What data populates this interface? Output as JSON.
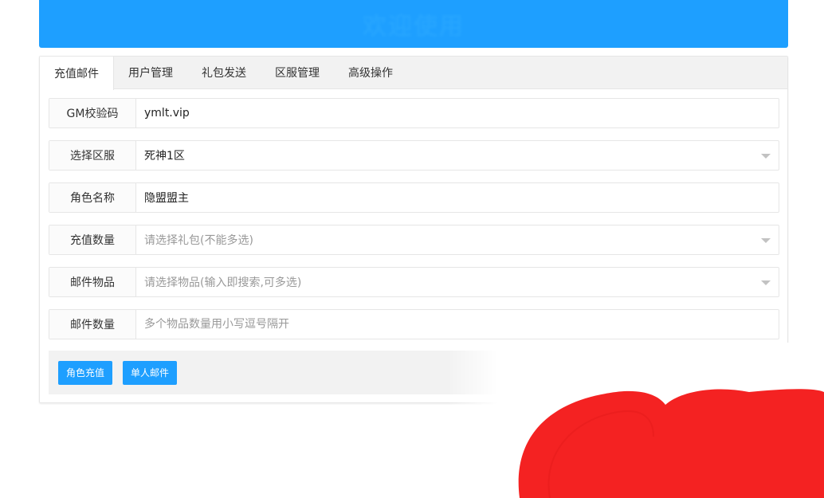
{
  "banner": {
    "title": "欢迎使用"
  },
  "tabs": [
    {
      "label": "充值邮件",
      "active": true
    },
    {
      "label": "用户管理",
      "active": false
    },
    {
      "label": "礼包发送",
      "active": false
    },
    {
      "label": "区服管理",
      "active": false
    },
    {
      "label": "高级操作",
      "active": false
    }
  ],
  "form": {
    "gm_code": {
      "label": "GM校验码",
      "value": "ymlt.vip"
    },
    "server": {
      "label": "选择区服",
      "value": "死神1区"
    },
    "role_name": {
      "label": "角色名称",
      "value": "隐盟盟主"
    },
    "recharge_amount": {
      "label": "充值数量",
      "placeholder": "请选择礼包(不能多选)"
    },
    "mail_items": {
      "label": "邮件物品",
      "placeholder": "请选择物品(输入即搜索,可多选)"
    },
    "mail_quantity": {
      "label": "邮件数量",
      "placeholder": "多个物品数量用小写逗号隔开"
    }
  },
  "actions": {
    "recharge_label": "角色充值",
    "single_mail_label": "单人邮件"
  },
  "colors": {
    "primary": "#1e9fff",
    "sticker_red": "#f42222"
  }
}
